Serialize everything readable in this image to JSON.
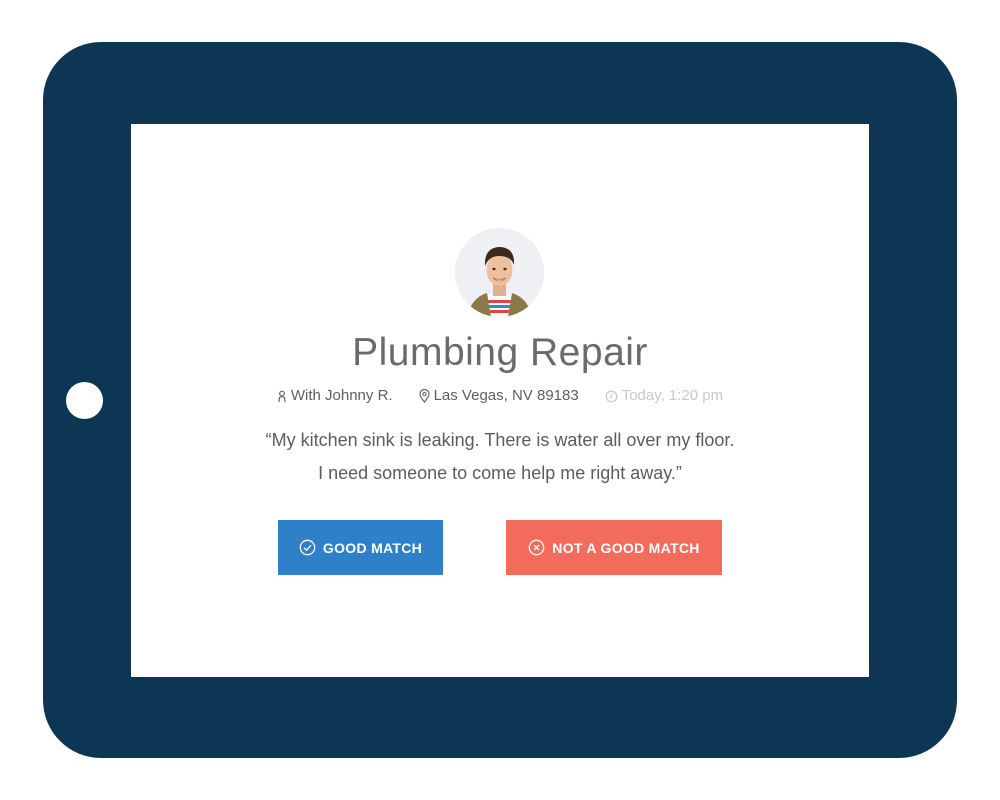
{
  "job": {
    "title": "Plumbing Repair",
    "customer": "With Johnny R.",
    "location": "Las Vegas, NV 89183",
    "time": "Today, 1:20 pm",
    "quote_line1": "“My kitchen sink is leaking. There is water all over my floor.",
    "quote_line2": "I need someone to come help me right away.”"
  },
  "actions": {
    "good_label": "GOOD MATCH",
    "bad_label": "NOT A GOOD MATCH"
  },
  "icons": {
    "customer": "person-icon",
    "location": "map-pin-icon",
    "time": "clock-icon",
    "good": "check-circle-icon",
    "bad": "x-circle-icon"
  },
  "colors": {
    "device": "#0d3655",
    "good_button": "#2e80c8",
    "bad_button": "#f26b5b",
    "text": "#5c5c5c",
    "muted": "#c8c8c8"
  }
}
